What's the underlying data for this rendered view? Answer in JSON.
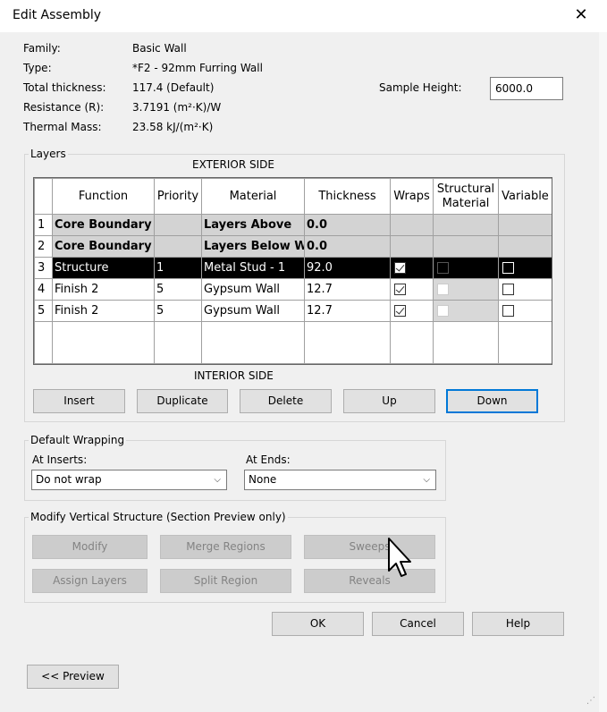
{
  "window": {
    "title": "Edit Assembly",
    "close_icon": "close-icon"
  },
  "info": {
    "family_label": "Family:",
    "family_value": "Basic Wall",
    "type_label": "Type:",
    "type_value": "*F2 - 92mm Furring Wall",
    "thickness_label": "Total thickness:",
    "thickness_value": "117.4 (Default)",
    "resistance_label": "Resistance (R):",
    "resistance_value": "3.7191 (m²·K)/W",
    "mass_label": "Thermal Mass:",
    "mass_value": "23.58 kJ/(m²·K)",
    "sample_height_label": "Sample Height:",
    "sample_height_value": "6000.0"
  },
  "layers": {
    "legend": "Layers",
    "exterior_caption": "EXTERIOR SIDE",
    "interior_caption": "INTERIOR SIDE",
    "columns": {
      "function": "Function",
      "priority": "Priority",
      "material": "Material",
      "thickness": "Thickness",
      "wraps": "Wraps",
      "structural_1": "Structural",
      "structural_2": "Material",
      "variable": "Variable"
    },
    "rows": [
      {
        "num": "1",
        "function": "Core Boundary",
        "priority": "",
        "material": "Layers Above",
        "thickness": "0.0"
      },
      {
        "num": "2",
        "function": "Core Boundary",
        "priority": "",
        "material": "Layers Below W",
        "thickness": "0.0"
      },
      {
        "num": "3",
        "function": "Structure",
        "priority": "1",
        "material": "Metal Stud - 1",
        "thickness": "92.0"
      },
      {
        "num": "4",
        "function": "Finish 2",
        "priority": "5",
        "material": "Gypsum Wall",
        "thickness": "12.7"
      },
      {
        "num": "5",
        "function": "Finish 2",
        "priority": "5",
        "material": "Gypsum Wall",
        "thickness": "12.7"
      }
    ],
    "buttons": {
      "insert": "Insert",
      "duplicate": "Duplicate",
      "delete": "Delete",
      "up": "Up",
      "down": "Down"
    }
  },
  "wrapping": {
    "legend": "Default Wrapping",
    "inserts_label": "At Inserts:",
    "inserts_value": "Do not wrap",
    "ends_label": "At  Ends:",
    "ends_value": "None"
  },
  "vertical": {
    "legend": "Modify Vertical Structure (Section Preview only)",
    "modify": "Modify",
    "merge": "Merge Regions",
    "sweeps": "Sweeps",
    "assign": "Assign Layers",
    "split": "Split Region",
    "reveals": "Reveals"
  },
  "footer": {
    "ok": "OK",
    "cancel": "Cancel",
    "help": "Help",
    "preview": "<< Preview"
  }
}
